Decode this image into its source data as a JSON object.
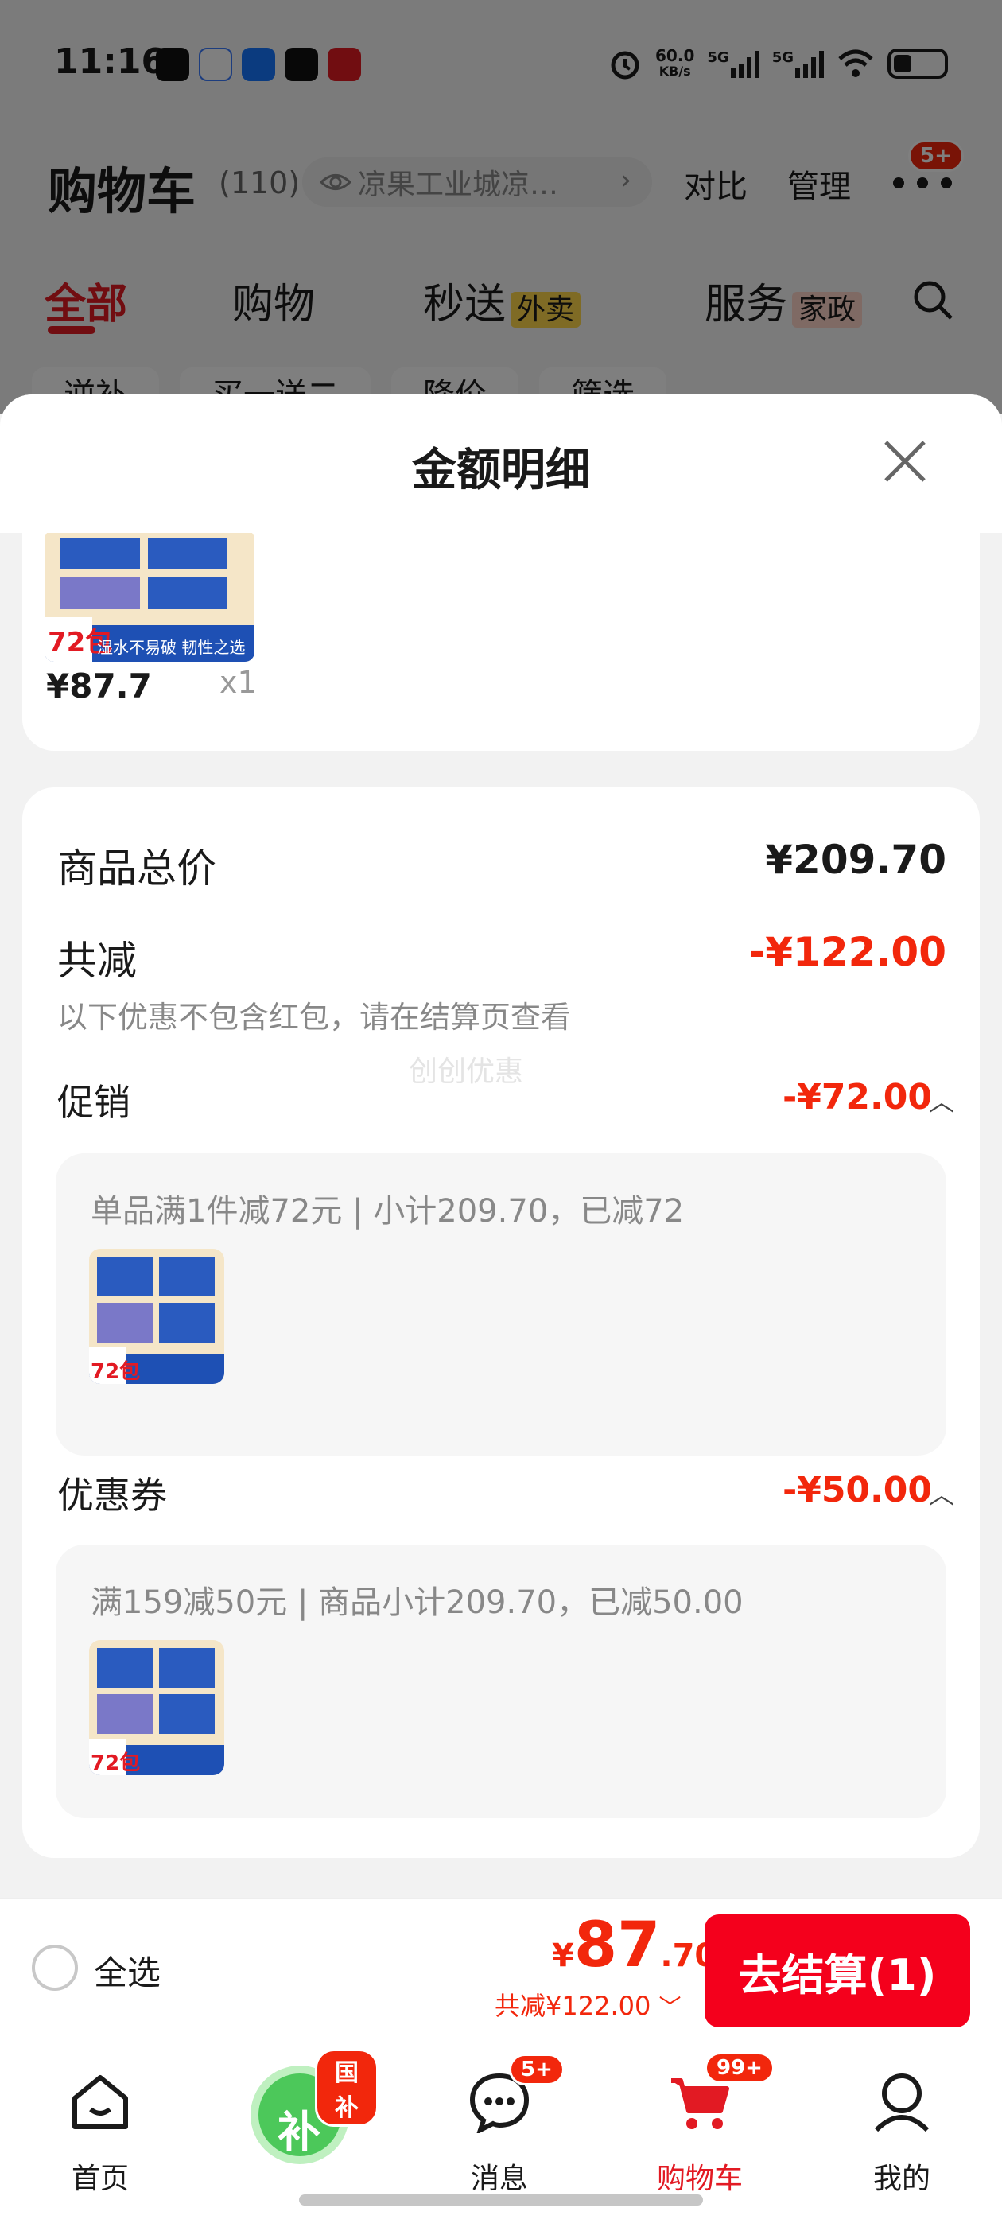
{
  "status_bar": {
    "time": "11:16",
    "net_speed": "60.0",
    "net_unit": "KB/s",
    "sim1": "5G",
    "sim2": "5G"
  },
  "cart_header": {
    "title": "购物车",
    "count": "(110)",
    "address": "凉果工业城凉…",
    "compare": "对比",
    "manage": "管理",
    "more_badge": "5+"
  },
  "tabs": [
    {
      "label": "全部"
    },
    {
      "label": "购物"
    },
    {
      "label": "秒送",
      "tag": "外卖"
    },
    {
      "label": "服务",
      "tag": "家政"
    }
  ],
  "chips": [
    "逆补",
    "买一送二",
    "降价",
    "筛选"
  ],
  "sheet": {
    "title": "金额明细",
    "top_item": {
      "price": "¥87.7",
      "qty": "x1"
    },
    "goods_total_label": "商品总价",
    "goods_total": "¥209.70",
    "reduce_label": "共减",
    "reduce_total": "-¥122.00",
    "reduce_note": "以下优惠不包含红包，请在结算页查看",
    "watermark": "创创优惠",
    "promo": {
      "label": "促销",
      "amount": "-¥72.00",
      "detail": "单品满1件减72元 | 小计209.70，已减72"
    },
    "coupon": {
      "label": "优惠券",
      "amount": "-¥50.00",
      "detail": "满159减50元 | 商品小计209.70，已减50.00"
    }
  },
  "product_image_text": {
    "pack": "72包",
    "slogan": "湿水不易破 韧性之选"
  },
  "checkout": {
    "select_all": "全选",
    "yen": "¥",
    "price_int": "87",
    "price_dec": ".70",
    "saved": "共减¥122.00",
    "pay_button": "去结算(1)"
  },
  "tabbar": {
    "home": "首页",
    "subsidy_badge": "国补",
    "subsidy_icon_text": "补",
    "messages": "消息",
    "messages_badge": "5+",
    "cart": "购物车",
    "cart_badge": "99+",
    "mine": "我的"
  },
  "colors": {
    "accent_red": "#f2270c",
    "button_red": "#f4001c"
  }
}
